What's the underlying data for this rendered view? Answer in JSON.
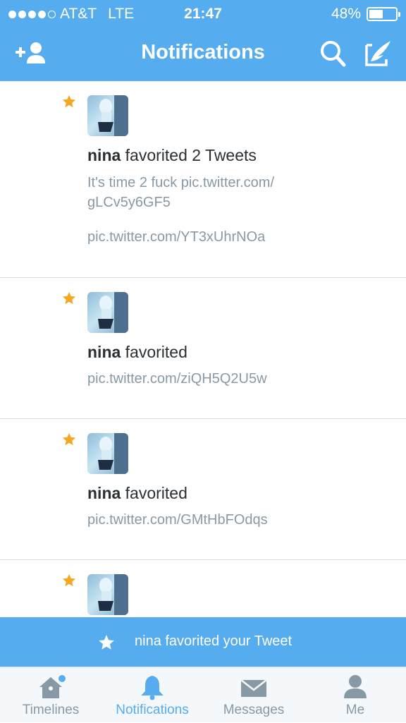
{
  "status_bar": {
    "carrier": "AT&T",
    "network": "LTE",
    "time": "21:47",
    "battery": "48%",
    "battery_level": 0.48,
    "signal_bars_filled": 4,
    "signal_bars_total": 5
  },
  "header": {
    "title": "Notifications",
    "add_user_icon": "add-user-icon",
    "search_icon": "search-icon",
    "compose_icon": "compose-icon"
  },
  "notifications": [
    {
      "user": "nina",
      "action": "favorited 2 Tweets",
      "lines": [
        "It's time 2 fuck pic.twitter.com/",
        "gLCv5y6GF5"
      ],
      "extra": "pic.twitter.com/YT3xUhrNOa"
    },
    {
      "user": "nina",
      "action": "favorited",
      "lines": [
        "pic.twitter.com/ziQH5Q2U5w"
      ]
    },
    {
      "user": "nina",
      "action": "favorited",
      "lines": [
        "pic.twitter.com/GMtHbFOdqs"
      ]
    },
    {
      "user": "",
      "action": "",
      "lines": []
    }
  ],
  "banner": {
    "text": "nina favorited your Tweet"
  },
  "tabs": [
    {
      "label": "Timelines",
      "icon": "home-icon",
      "has_dot": true
    },
    {
      "label": "Notifications",
      "icon": "bell-icon",
      "active": true
    },
    {
      "label": "Messages",
      "icon": "envelope-icon"
    },
    {
      "label": "Me",
      "icon": "person-icon"
    }
  ],
  "colors": {
    "accent": "#55acee",
    "star": "#f5a623",
    "text": "#292f33",
    "muted": "#8899a6"
  }
}
